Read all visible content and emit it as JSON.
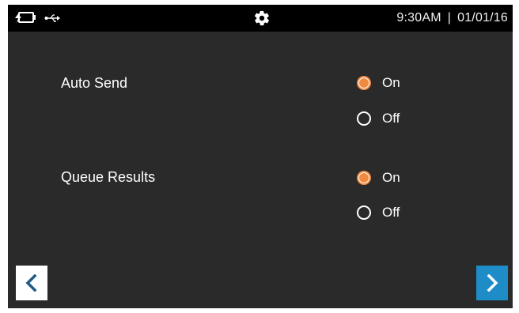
{
  "status_bar": {
    "left_icons": [
      "battery-charging-icon",
      "usb-icon"
    ],
    "center_icon": "gear-icon",
    "time": "9:30AM",
    "separator": "|",
    "date": "01/01/16"
  },
  "settings": [
    {
      "label": "Auto Send",
      "options": [
        {
          "label": "On",
          "selected": true
        },
        {
          "label": "Off",
          "selected": false
        }
      ]
    },
    {
      "label": "Queue Results",
      "options": [
        {
          "label": "On",
          "selected": true
        },
        {
          "label": "Off",
          "selected": false
        }
      ]
    }
  ],
  "nav": {
    "back_icon": "chevron-left-icon",
    "next_icon": "chevron-right-icon"
  },
  "colors": {
    "background": "#2a2a2a",
    "status_bar": "#000000",
    "radio_selected": "#f08a40",
    "next_button": "#1d8cc7",
    "back_button": "#ffffff"
  }
}
